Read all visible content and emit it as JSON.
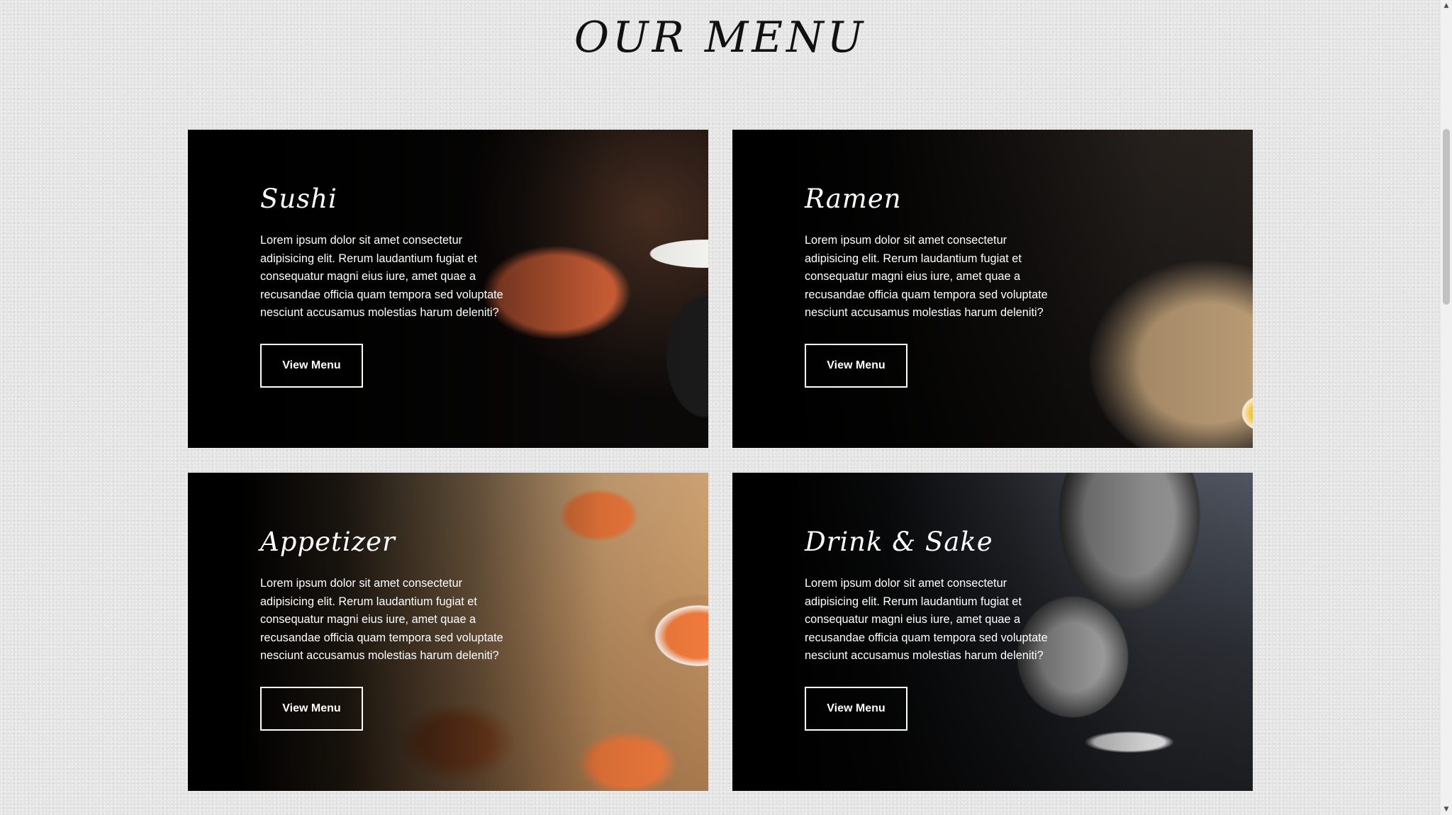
{
  "page": {
    "title": "OUR MENU"
  },
  "menu": {
    "items": [
      {
        "name": "Sushi",
        "description": "Lorem ipsum dolor sit amet consectetur adipisicing elit. Rerum laudantium fugiat et consequatur magni eius iure, amet quae a recusandae officia quam tempora sed voluptate nesciunt accusamus molestias harum deleniti?",
        "button_label": "View Menu"
      },
      {
        "name": "Ramen",
        "description": "Lorem ipsum dolor sit amet consectetur adipisicing elit. Rerum laudantium fugiat et consequatur magni eius iure, amet quae a recusandae officia quam tempora sed voluptate nesciunt accusamus molestias harum deleniti?",
        "button_label": "View Menu"
      },
      {
        "name": "Appetizer",
        "description": "Lorem ipsum dolor sit amet consectetur adipisicing elit. Rerum laudantium fugiat et consequatur magni eius iure, amet quae a recusandae officia quam tempora sed voluptate nesciunt accusamus molestias harum deleniti?",
        "button_label": "View Menu"
      },
      {
        "name": "Drink & Sake",
        "description": "Lorem ipsum dolor sit amet consectetur adipisicing elit. Rerum laudantium fugiat et consequatur magni eius iure, amet quae a recusandae officia quam tempora sed voluptate nesciunt accusamus molestias harum deleniti?",
        "button_label": "View Menu"
      }
    ]
  },
  "scrollbar": {
    "up_icon": "arrow-up-icon",
    "down_icon": "arrow-down-icon"
  }
}
